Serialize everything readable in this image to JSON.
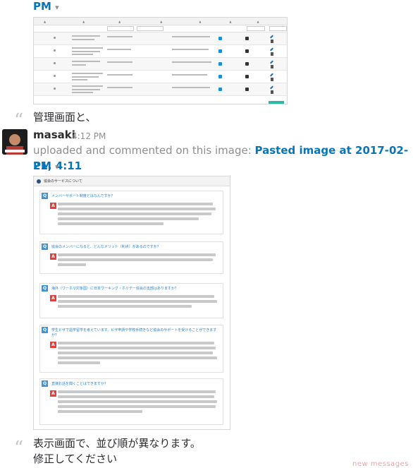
{
  "messages": [
    {
      "continuation_text": "PM",
      "continuation_caret": "▾"
    },
    {
      "comment": "管理画面と、"
    },
    {
      "author": "masaki",
      "time": "4:12 PM",
      "upload_prefix": "uploaded and commented on this image: ",
      "file_title_line1": "Pasted image at 2017-02-21, 4:11",
      "file_title_line2": "PM",
      "caret": "▾",
      "faq_header": "協会のサービスについて",
      "faq_items": [
        {
          "q": "メンバーサポート制度とはなんですか？"
        },
        {
          "q": "協会のメンバーになると、どんなメリット（利点）があるのですか？"
        },
        {
          "q": "海外（ワーホリ対象国）に日本ワーキング・ホリデー協会の支部はありますか？"
        },
        {
          "q": "学生ビザで語学留学を考えています。ビザ申請や学校手続きなど協会のサポートを受けることができますか？"
        },
        {
          "q": "直接お話を聞くことはできますか？"
        }
      ]
    },
    {
      "comment_line1": "表示画面で、並び順が異なります。",
      "comment_line2": "修正してください"
    }
  ],
  "footer": {
    "new_messages": "new messages"
  },
  "icons": {
    "quote": "quote-icon",
    "caret": "caret-down-icon"
  }
}
